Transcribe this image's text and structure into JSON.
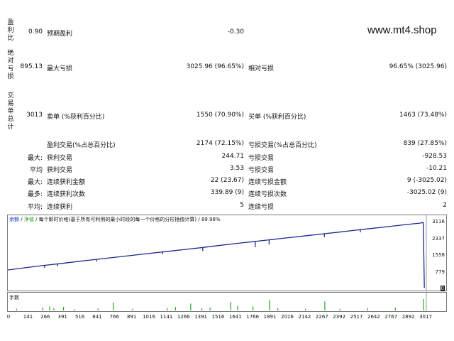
{
  "watermark": "www.mt4.shop",
  "row_profit_factor": {
    "side_label": [
      "盈",
      "利",
      "比"
    ],
    "left_value": "0.90",
    "label": "预期盈利",
    "value": "-0.30"
  },
  "row_drawdown": {
    "side_label": [
      "绝",
      "对",
      "亏",
      "损"
    ],
    "left_value": "895.13",
    "label": "最大亏损",
    "value": "3025.96 (96.65%)",
    "label2": "相对亏损",
    "value2": "96.65% (3025.96)"
  },
  "row_trades": {
    "side_label": [
      "交",
      "易",
      "单",
      "总",
      "计"
    ],
    "left_value": "3013",
    "label": "卖单 (%获利百分比)",
    "value": "1550 (70.90%)",
    "label2": "买单 (%获利百分比)",
    "value2": "1463 (73.48%)"
  },
  "stats": [
    {
      "prefix": "",
      "label": "盈利交易(%占总百分比)",
      "value": "2174 (72.15%)",
      "label2": "亏损交易(%占总百分比)",
      "value2": "839 (27.85%)"
    },
    {
      "prefix": "最大:",
      "label": "获利交易",
      "value": "244.71",
      "label2": "亏损交易",
      "value2": "-928.53"
    },
    {
      "prefix": "平均",
      "label": "获利交易",
      "value": "3.53",
      "label2": "亏损交易",
      "value2": "-10.21"
    },
    {
      "prefix": "最大:",
      "label": "连续获利金额",
      "value": "22 (23.67)",
      "label2": "连续亏损金额",
      "value2": "9 (-3025.02)"
    },
    {
      "prefix": "最多:",
      "label": "连续获利次数",
      "value": "339.89 (9)",
      "label2": "连续亏损次数",
      "value2": "-3025.02 (9)"
    },
    {
      "prefix": "平均:",
      "label": "连续获利",
      "value": "5",
      "label2": "连续亏损",
      "value2": "2"
    }
  ],
  "chart_header": {
    "balance": "余额",
    "equity": "净值",
    "model": "每个即时价格(基于所有可利用的最小时段的每一个价格的分形插值计算)",
    "quality": "89.98%"
  },
  "volume_title": "手数",
  "colors": {
    "balance_line": "#1c2a8c",
    "volume_bars": "#22aa22"
  },
  "chart_data": {
    "type": "line",
    "title": "",
    "xlabel": "",
    "ylabel": "",
    "x_ticks": [
      "0",
      "141",
      "266",
      "391",
      "516",
      "641",
      "766",
      "891",
      "1016",
      "1141",
      "1266",
      "1391",
      "1516",
      "1641",
      "1766",
      "1891",
      "2016",
      "2142",
      "2267",
      "2392",
      "2517",
      "2642",
      "2767",
      "2892",
      "3017"
    ],
    "y_ticks": [
      "3116",
      "2337",
      "1558",
      "779",
      "0"
    ],
    "xlim": [
      0,
      3017
    ],
    "ylim": [
      0,
      3116
    ],
    "series": [
      {
        "x": [
          0,
          141,
          266,
          391,
          516,
          641,
          766,
          891,
          1016,
          1141,
          1266,
          1391,
          1516,
          1641,
          1766,
          1891,
          2016,
          2142,
          2267,
          2392,
          2517,
          2642,
          2767,
          2892,
          2980,
          3005,
          3013
        ],
        "y": [
          895,
          1010,
          1110,
          1200,
          1300,
          1390,
          1480,
          1570,
          1660,
          1750,
          1840,
          1930,
          2030,
          2120,
          2210,
          2300,
          2390,
          2480,
          2570,
          2660,
          2750,
          2840,
          2930,
          3020,
          3080,
          3110,
          60
        ]
      }
    ],
    "drops": [
      {
        "x": 266,
        "y": 1000
      },
      {
        "x": 360,
        "y": 1060
      },
      {
        "x": 640,
        "y": 1280
      },
      {
        "x": 1120,
        "y": 1640
      },
      {
        "x": 1410,
        "y": 1780
      },
      {
        "x": 1790,
        "y": 1960
      },
      {
        "x": 1890,
        "y": 2080
      },
      {
        "x": 2290,
        "y": 2430
      },
      {
        "x": 2550,
        "y": 2650
      }
    ],
    "volume_bars": [
      {
        "x": 60,
        "v": 0.15
      },
      {
        "x": 250,
        "v": 0.25
      },
      {
        "x": 300,
        "v": 0.35
      },
      {
        "x": 330,
        "v": 0.2
      },
      {
        "x": 400,
        "v": 0.3
      },
      {
        "x": 480,
        "v": 0.12
      },
      {
        "x": 650,
        "v": 0.18
      },
      {
        "x": 760,
        "v": 0.7
      },
      {
        "x": 900,
        "v": 0.15
      },
      {
        "x": 1150,
        "v": 0.2
      },
      {
        "x": 1210,
        "v": 0.3
      },
      {
        "x": 1320,
        "v": 0.6
      },
      {
        "x": 1400,
        "v": 0.2
      },
      {
        "x": 1460,
        "v": 0.25
      },
      {
        "x": 1610,
        "v": 0.75
      },
      {
        "x": 1660,
        "v": 0.4
      },
      {
        "x": 1770,
        "v": 0.35
      },
      {
        "x": 1890,
        "v": 0.95
      },
      {
        "x": 1950,
        "v": 0.2
      },
      {
        "x": 2150,
        "v": 0.15
      },
      {
        "x": 2290,
        "v": 0.8
      },
      {
        "x": 2400,
        "v": 0.15
      },
      {
        "x": 2600,
        "v": 0.2
      },
      {
        "x": 2800,
        "v": 0.25
      },
      {
        "x": 3005,
        "v": 1.0
      }
    ]
  }
}
